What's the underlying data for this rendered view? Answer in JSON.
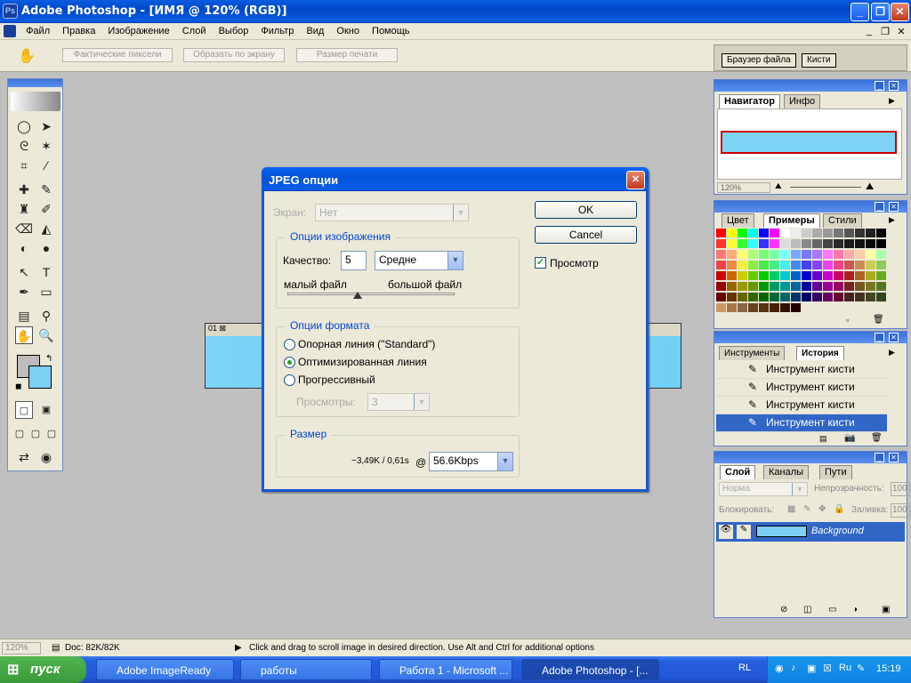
{
  "window": {
    "title": "Adobe Photoshop - [ИМЯ @ 120% (RGB)]"
  },
  "menu": [
    "Файл",
    "Правка",
    "Изображение",
    "Слой",
    "Выбор",
    "Фильтр",
    "Вид",
    "Окно",
    "Помощь"
  ],
  "options_bar": {
    "actual_pixels": "Фактические пиксели",
    "fit_screen": "Образать по экрану",
    "print_size": "Размер печати"
  },
  "palette_well": {
    "tabs": [
      "Браузер файла",
      "Кисти"
    ]
  },
  "image_window": {
    "label": "01"
  },
  "dialog": {
    "title": "JPEG опции",
    "screen_label": "Экран:",
    "screen_value": "Нет",
    "ok": "OK",
    "cancel": "Cancel",
    "preview": "Просмотр",
    "preview_checked": true,
    "image_options": {
      "title": "Опции изображения",
      "quality_label": "Качество:",
      "quality_value": "5",
      "quality_preset": "Средне",
      "small_file": "малый файл",
      "large_file": "большой файл",
      "slider_fraction": 0.42
    },
    "format_options": {
      "title": "Опции формата",
      "opt1": "Опорная линия (\"Standard\")",
      "opt2": "Оптимизированная линия",
      "opt3": "Прогрессивный",
      "selected": 2,
      "scans_label": "Просмотры:",
      "scans_value": "3"
    },
    "size": {
      "title": "Размер",
      "estimate": "~3,49K / 0,61s",
      "at": "@",
      "speed": "56.6Kbps"
    }
  },
  "navigator": {
    "tabs": [
      "Навигатор",
      "Инфо"
    ],
    "zoom": "120%"
  },
  "swatches": {
    "tabs": [
      "Цвет",
      "Примеры",
      "Стили"
    ]
  },
  "history": {
    "tabs": [
      "Инструменты",
      "История"
    ],
    "items": [
      "Инструмент кисти",
      "Инструмент кисти",
      "Инструмент кисти",
      "Инструмент кисти"
    ]
  },
  "layers": {
    "tabs": [
      "Слой",
      "Каналы",
      "Пути"
    ],
    "blend": "Норма",
    "opacity_label": "Непрозрачность:",
    "opacity": "100",
    "lock_label": "Блокировать:",
    "fill_label": "Заливка:",
    "fill": "100",
    "layer": "Background"
  },
  "status": {
    "zoom": "120%",
    "doc": "Doc: 82K/82K",
    "hint": "Click and drag to scroll image in desired direction.  Use Alt and Ctrl for additional options"
  },
  "taskbar": {
    "start": "пуск",
    "tasks": [
      "Adobe ImageReady",
      "работы",
      "Работа 1 - Microsoft ...",
      "Adobe Photoshop - [..."
    ],
    "lang": "RL",
    "clock": "15:19"
  }
}
